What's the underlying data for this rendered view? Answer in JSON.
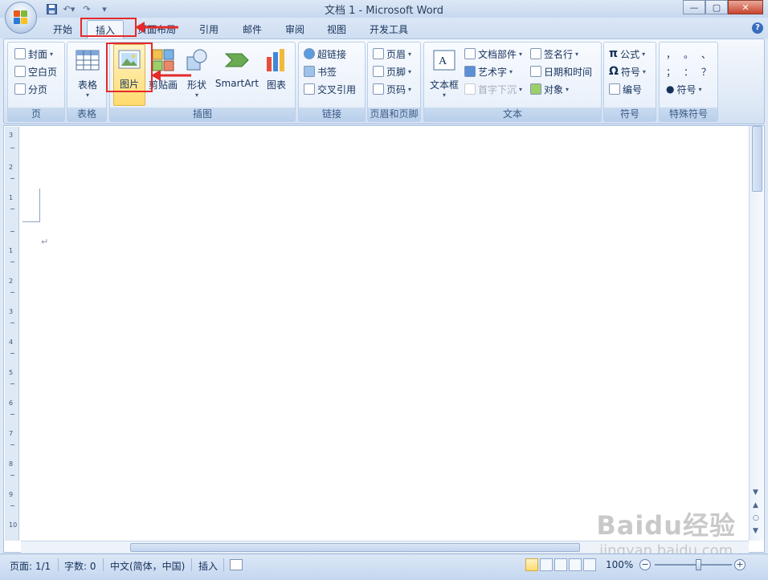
{
  "window": {
    "title": "文档 1 - Microsoft Word"
  },
  "tabs": [
    "开始",
    "插入",
    "页面布局",
    "引用",
    "邮件",
    "审阅",
    "视图",
    "开发工具"
  ],
  "active_tab": "插入",
  "ribbon": {
    "page": {
      "label": "页",
      "items": [
        "封面",
        "空白页",
        "分页"
      ]
    },
    "table": {
      "label": "表格",
      "button": "表格"
    },
    "illustrations": {
      "label": "插图",
      "buttons": [
        "图片",
        "剪贴画",
        "形状",
        "SmartArt",
        "图表"
      ]
    },
    "links": {
      "label": "链接",
      "items": [
        "超链接",
        "书签",
        "交叉引用"
      ]
    },
    "header_footer": {
      "label": "页眉和页脚",
      "items": [
        "页眉",
        "页脚",
        "页码"
      ]
    },
    "text": {
      "label": "文本",
      "textbox": "文本框",
      "items": [
        "文档部件",
        "艺术字",
        "首字下沉",
        "签名行",
        "日期和时间",
        "对象"
      ]
    },
    "symbols": {
      "label": "符号",
      "items": [
        "公式",
        "符号",
        "编号"
      ]
    },
    "special": {
      "label": "特殊符号",
      "chars": [
        "，",
        "。",
        "、",
        "；",
        "：",
        "？"
      ],
      "button": "符号"
    }
  },
  "statusbar": {
    "page": "页面: 1/1",
    "words": "字数: 0",
    "language": "中文(简体，中国)",
    "mode": "插入",
    "zoom": "100%"
  },
  "watermark": {
    "logo": "Baidu经验",
    "url": "jingyan.baidu.com"
  },
  "colors": {
    "highlight": "#ffdb6e",
    "annotation": "#e42a2a"
  }
}
